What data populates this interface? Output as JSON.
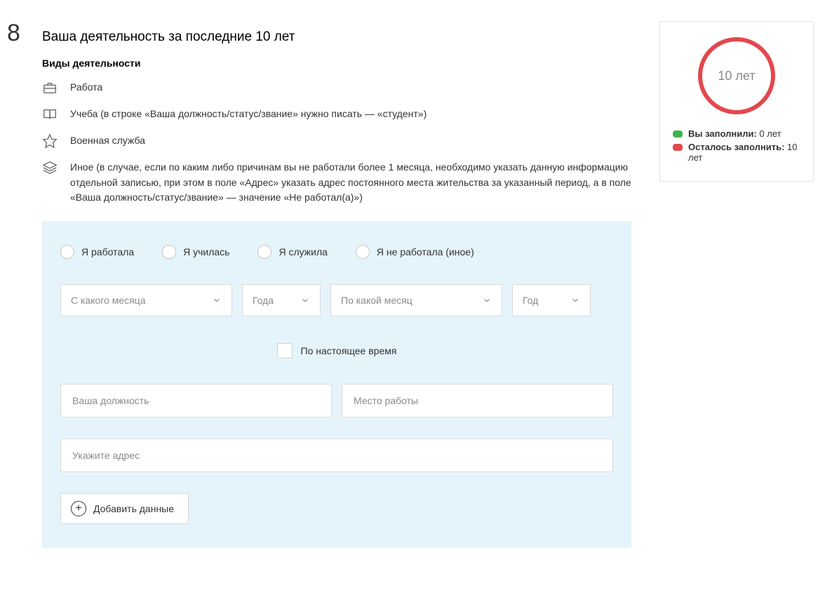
{
  "step": "8",
  "title": "Ваша деятельность за последние 10 лет",
  "subtitle": "Виды деятельности",
  "legend": [
    {
      "icon": "briefcase-icon",
      "text": "Работа"
    },
    {
      "icon": "book-icon",
      "text": "Учеба (в строке «Ваша должность/статус/звание» нужно писать — «студент»)"
    },
    {
      "icon": "star-icon",
      "text": "Военная служба"
    },
    {
      "icon": "stack-icon",
      "text": "Иное (в случае, если по каким либо причинам вы не работали более 1 месяца, необходимо указать данную информацию отдельной записью, при этом в поле «Адрес» указать адрес постоянного места жительства за указанный период, а в поле «Ваша должность/статус/звание» — значение «Не работал(а)»)"
    }
  ],
  "form": {
    "radios": [
      "Я работала",
      "Я училась",
      "Я служила",
      "Я не работала (иное)"
    ],
    "selects": {
      "from_month": "С какого месяца",
      "from_year": "Года",
      "to_month": "По какой месяц",
      "to_year": "Год"
    },
    "present_checkbox": "По настоящее время",
    "inputs": {
      "position": "Ваша должность",
      "workplace": "Место работы",
      "address": "Укажите адрес"
    },
    "add_button": "Добавить данные"
  },
  "sidebar": {
    "ring_label": "10 лет",
    "filled_label": "Вы заполнили:",
    "filled_value": "0 лет",
    "remaining_label": "Осталось заполнить:",
    "remaining_value": "10 лет"
  }
}
